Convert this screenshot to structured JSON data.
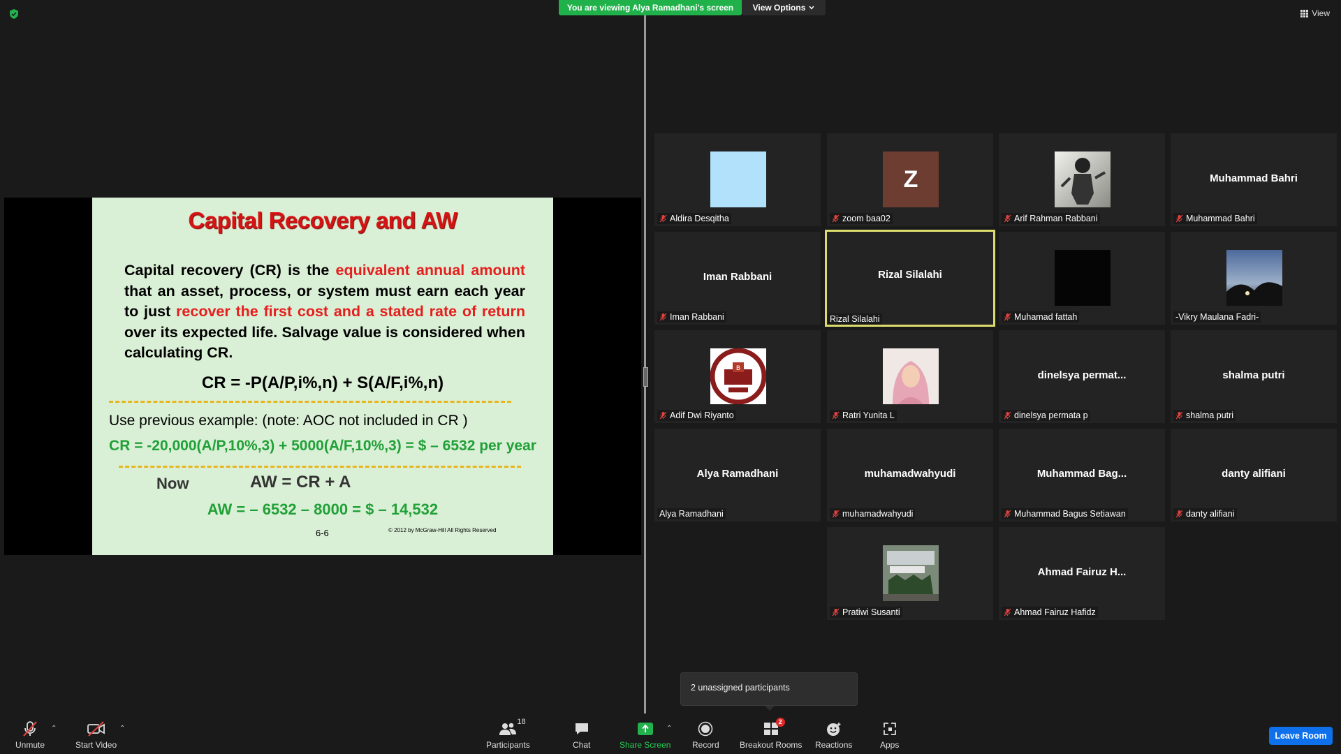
{
  "top": {
    "viewing_banner": "You are viewing Alya Ramadhani's screen",
    "view_options": "View Options",
    "view": "View"
  },
  "slide": {
    "title": "Capital Recovery and AW",
    "para_1": "Capital recovery (CR) is the ",
    "para_red_1": "equivalent annual amount",
    "para_2": " that an asset, process, or system must earn each year to just ",
    "para_red_2": "recover the first cost and a stated rate of return",
    "para_3": " over its expected life. Salvage value is considered when calculating CR.",
    "formula": "CR = -P(A/P,i%,n) + S(A/F,i%,n)",
    "previous": "Use previous example:  (note: AOC not included in CR )",
    "cr_equation": "CR = -20,000(A/P,10%,3) + 5000(A/F,10%,3) = $ – 6532 per year",
    "now": "Now",
    "aw_formula": "AW = CR + A",
    "aw_equation": "AW = – 6532 – 8000 = $ – 14,532",
    "slide_number": "6-6",
    "copyright": "© 2012 by McGraw-Hill     All Rights Reserved"
  },
  "participants": [
    {
      "name": "Aldira Desqitha",
      "big": "",
      "pic": "light-blue-square",
      "muted": true
    },
    {
      "name": "zoom baa02",
      "big": "",
      "pic": "letter-z-avatar",
      "letter": "Z",
      "muted": true
    },
    {
      "name": "Arif Rahman Rabbani",
      "big": "",
      "pic": "cartoon-photo",
      "muted": true
    },
    {
      "name": "Muhammad Bahri",
      "big": "Muhammad Bahri",
      "pic": "",
      "muted": true
    },
    {
      "name": "Iman Rabbani",
      "big": "Iman Rabbani",
      "pic": "",
      "muted": true
    },
    {
      "name": "Rizal Silalahi",
      "big": "Rizal Silalahi",
      "pic": "",
      "muted": false
    },
    {
      "name": "Muhamad fattah",
      "big": "",
      "pic": "black-square",
      "muted": true
    },
    {
      "name": "-Vikry Maulana Fadri-",
      "big": "",
      "pic": "sunset-photo",
      "muted": false
    },
    {
      "name": "Adif Dwi Riyanto",
      "big": "",
      "pic": "teknik-industri-logo",
      "muted": true
    },
    {
      "name": "Ratri Yunita L",
      "big": "",
      "pic": "hijab-portrait",
      "muted": true
    },
    {
      "name": "dinelsya permata p",
      "big": "dinelsya  permat...",
      "pic": "",
      "muted": true
    },
    {
      "name": "shalma putri",
      "big": "shalma putri",
      "pic": "",
      "muted": true
    },
    {
      "name": "Alya Ramadhani",
      "big": "Alya Ramadhani",
      "pic": "",
      "muted": false
    },
    {
      "name": "muhamadwahyudi",
      "big": "muhamadwahyudi",
      "pic": "",
      "muted": true
    },
    {
      "name": "Muhammad Bagus Setiawan",
      "big": "Muhammad  Bag...",
      "pic": "",
      "muted": true
    },
    {
      "name": "danty alifiani",
      "big": "danty alifiani",
      "pic": "",
      "muted": true
    },
    {
      "name": "Pratiwi Susanti",
      "big": "",
      "pic": "building-photo",
      "muted": true
    },
    {
      "name": "Ahmad Fairuz Hafidz",
      "big": "Ahmad  Fairuz  H...",
      "pic": "",
      "muted": true
    }
  ],
  "popup": {
    "text": "2 unassigned participants"
  },
  "toolbar": {
    "unmute": "Unmute",
    "start_video": "Start Video",
    "participants": "Participants",
    "participants_count": "18",
    "chat": "Chat",
    "share_screen": "Share Screen",
    "record": "Record",
    "breakout_rooms": "Breakout Rooms",
    "breakout_badge": "2",
    "reactions": "Reactions",
    "apps": "Apps",
    "leave_room": "Leave Room"
  },
  "colors": {
    "banner_green": "#21b14b",
    "slide_bg": "#daf0d6",
    "slide_red": "#e51e1e",
    "slide_green": "#21a038",
    "leave_blue": "#0e71eb",
    "active_border": "#dcdc6e"
  }
}
